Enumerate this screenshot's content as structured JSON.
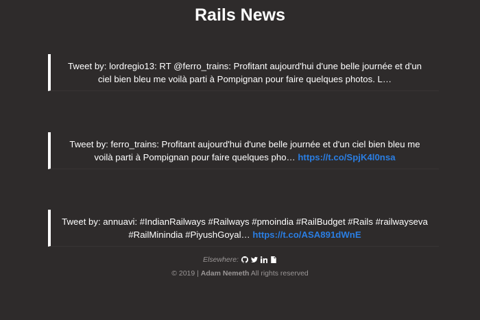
{
  "page": {
    "title": "Rails News"
  },
  "tweets": [
    {
      "text": "Tweet by: lordregio13: RT @ferro_trains: Profitant aujourd'hui d'une belle journée et d'un ciel bien bleu me voilà parti à Pompignan pour faire quelques photos. L…",
      "link": ""
    },
    {
      "text": "Tweet by: ferro_trains: Profitant aujourd'hui d'une belle journée et d'un ciel bien bleu me voilà parti à Pompignan pour faire quelques pho… ",
      "link": "https://t.co/SpjK4l0nsa"
    },
    {
      "text": "Tweet by: annuavi: #IndianRailways #Railways #pmoindia #RailBudget #Rails #railwayseva #RailMinindia #PiyushGoyal… ",
      "link": "https://t.co/ASA891dWnE"
    }
  ],
  "footer": {
    "elsewhere_label": "Elsewhere:",
    "icons": [
      "github-icon",
      "twitter-icon",
      "linkedin-icon",
      "document-icon"
    ],
    "copyright_prefix": "© 2019 | ",
    "author": "Adam Nemeth",
    "copyright_suffix": " All rights reserved"
  },
  "colors": {
    "background": "#2e2b2b",
    "text": "#ffffff",
    "link": "#2a7ee3",
    "muted": "#9a9696",
    "accent_border": "#ffffff"
  }
}
